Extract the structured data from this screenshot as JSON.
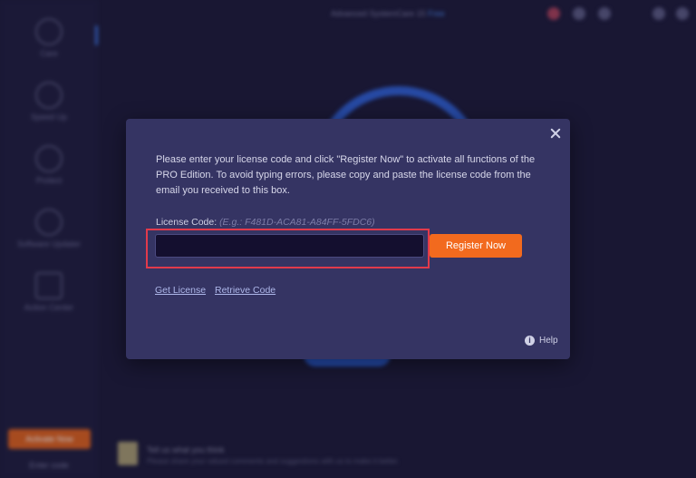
{
  "app": {
    "title_prefix": "Advanced SystemCare 15",
    "title_edition": "Free",
    "activate_label": "Activate Now",
    "enter_code_label": "Enter code"
  },
  "sidebar": {
    "items": [
      {
        "label": "Care"
      },
      {
        "label": "Speed Up"
      },
      {
        "label": "Protect"
      },
      {
        "label": "Software Updater"
      },
      {
        "label": "Action Center"
      }
    ]
  },
  "footer": {
    "title": "Tell us what you think",
    "subtitle": "Please share your valued comments and suggestions with us to make it better."
  },
  "dialog": {
    "description": "Please enter your license code and click \"Register Now\" to activate all functions of the PRO Edition. To avoid typing errors, please copy and paste the license code from the email you received to this box.",
    "license_label": "License Code:",
    "license_example": "(E.g.: F481D-ACA81-A84FF-5FDC6)",
    "license_value": "",
    "register_label": "Register Now",
    "get_license_label": "Get License",
    "retrieve_code_label": "Retrieve Code",
    "help_label": "Help",
    "help_icon_glyph": "i"
  },
  "colors": {
    "accent_orange": "#f26a1e",
    "highlight_red": "#e23a4b",
    "dialog_bg": "#353463"
  }
}
